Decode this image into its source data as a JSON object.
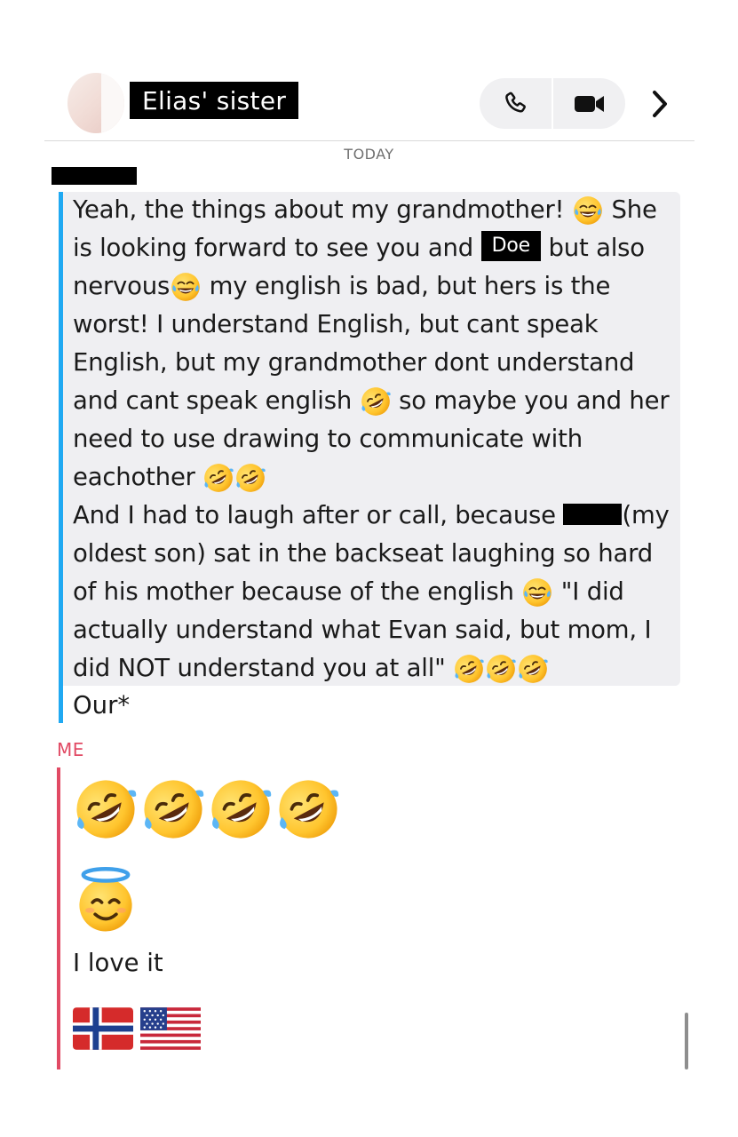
{
  "header": {
    "title": "Elias' sister",
    "call_icon": "phone-icon",
    "video_icon": "video-camera-icon",
    "more_icon": "chevron-right-icon"
  },
  "date_divider": "TODAY",
  "received": {
    "lines": [
      "Yeah, the things about my grandmother! ",
      " She",
      "is looking forward to see you and ",
      "Doe",
      " but also",
      "nervous",
      " my english is bad, but hers is the",
      "worst! I understand English, but cant speak",
      "English, but my grandmother dont understand",
      "and cant speak english ",
      " so maybe you and her",
      "need to use drawing to communicate with",
      "eachother ",
      "And I had to laugh after or call, because ",
      "(my",
      "oldest son) sat in the backseat laughing so hard",
      "of his mother because of the english ",
      " \"I did",
      "actually understand what Evan said, but mom, I",
      "did NOT understand you at all\" "
    ],
    "correction": "Our*"
  },
  "me": {
    "label": "ME",
    "text": "I love it",
    "emojis": [
      "rofl",
      "rofl",
      "rofl",
      "rofl",
      "smiling-face-with-halo",
      "flag-norway",
      "flag-usa"
    ]
  },
  "colors": {
    "incoming_bar": "#20a9f2",
    "me_bar": "#e14a64",
    "bubble": "#efeff2"
  }
}
